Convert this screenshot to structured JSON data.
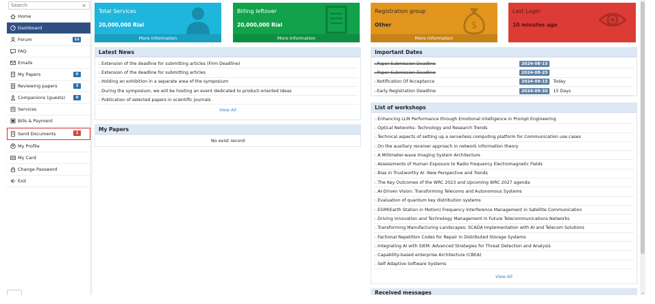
{
  "search": {
    "placeholder": "Search",
    "clear_icon": "close-icon"
  },
  "sidebar": {
    "items": [
      {
        "label": "Home",
        "icon": "home-icon"
      },
      {
        "label": "Dashboard",
        "icon": "dashboard-icon",
        "active": true
      },
      {
        "label": "Forum",
        "icon": "user-icon",
        "badge": "12",
        "badge_color": "#2f6fa8"
      },
      {
        "label": "FAQ",
        "icon": "chat-icon"
      },
      {
        "label": "Emails",
        "icon": "email-icon"
      },
      {
        "label": "My Papers",
        "icon": "paper-icon",
        "badge": "0",
        "badge_color": "#2f6fa8"
      },
      {
        "label": "Reviewing papers",
        "icon": "review-icon",
        "badge": "3",
        "badge_color": "#2f6fa8"
      },
      {
        "label": "Companions (guests)",
        "icon": "companions-icon",
        "badge": "0",
        "badge_color": "#2f6fa8"
      },
      {
        "label": "Services",
        "icon": "services-icon"
      },
      {
        "label": "Bills & Payment",
        "icon": "bill-icon"
      },
      {
        "label": "Send Documents",
        "icon": "document-icon",
        "badge": "1",
        "badge_color": "#d0463f",
        "highlighted": true
      },
      {
        "label": "My Profile",
        "icon": "profile-icon"
      },
      {
        "label": "My Card",
        "icon": "card-icon"
      },
      {
        "label": "Change Password",
        "icon": "lock-icon"
      },
      {
        "label": "Exit",
        "icon": "exit-icon"
      }
    ]
  },
  "cards": {
    "services": {
      "title": "Total Services",
      "value": "20,000,000 Rial",
      "more": "More Information",
      "color": "#1eb6dc"
    },
    "billing": {
      "title": "Billing leftover",
      "value": "20,000,000 Rial",
      "more": "More Information",
      "color": "#11a24b"
    },
    "registration": {
      "title": "Registration group",
      "value": "Other",
      "more": "More Information",
      "color": "#e2961e"
    },
    "login": {
      "title": "Last Login",
      "value": "10 minutes ago",
      "color": "#dd3b36"
    }
  },
  "news": {
    "title": "Latest News",
    "items": [
      "Extension of the deadline for submitting articles (Firm Deadline)",
      "Extension of the deadline for submitting articles",
      "Holding an exhibition in a separate area of the symposium",
      "During the symposium, we will be hosting an event dedicated to product-oriented ideas",
      "Publication of selected papers in scientific journals"
    ],
    "view_all": "View All"
  },
  "papers": {
    "title": "My Papers",
    "empty": "No exist record"
  },
  "dates": {
    "title": "Important Dates",
    "items": [
      {
        "label": "Paper Submission Deadline",
        "date": "2024-08-15",
        "note": "",
        "strike": true
      },
      {
        "label": "Paper Submission Deadline",
        "date": "2024-08-25",
        "note": "",
        "strike": true
      },
      {
        "label": "Notification Of Acceptance",
        "date": "2024-09-15",
        "note": "Today",
        "strike": false
      },
      {
        "label": "Early Registration Deadline",
        "date": "2024-09-30",
        "note": "15 Days",
        "strike": false
      }
    ]
  },
  "workshops": {
    "title": "List of workshops",
    "items": [
      "Enhancing LLM Performance through Emotional Intelligence in Prompt Engineering",
      "Optical Networks: Technology and Research Trends",
      "Technical aspects of setting up a serverless computing platform for Communication use cases",
      "On the auxiliary receiver approach in network information theory",
      "A Millimeter-wave Imaging System Architecture",
      "Assessments of Human Exposure to Radio Frequency Electromagnetic Fields",
      "Bias in Trustworthy AI :New Perspective and Trends",
      "The Key Outcomes of the WRC 2023 and Upcoming WRC 2027 agenda",
      "AI-Driven Vision: Transforming Telecoms and Autonomous Systems",
      "Evaluation of quantum key distribution systems",
      "ESIM(Earth Station in Motion) Frequency Interference Management in Satellite Communication",
      "Driving Innovation and Technology Management in Future Telecommunications Networks",
      "Transforming Manufacturing Landscapes: SCADA Implementation with AI and Telecom Solutions",
      "Factional Repetition Codes for Repair in Distributed Storage Systems",
      "Integrating AI with SIEM: Advanced Strategies for Threat Detection and Analysis",
      "Capability-based enterprise Architecture (CBEA)",
      "Self Adaptive Software Systems"
    ],
    "view_all": "View All"
  },
  "received": {
    "title": "Received messages"
  },
  "bullet": ":."
}
